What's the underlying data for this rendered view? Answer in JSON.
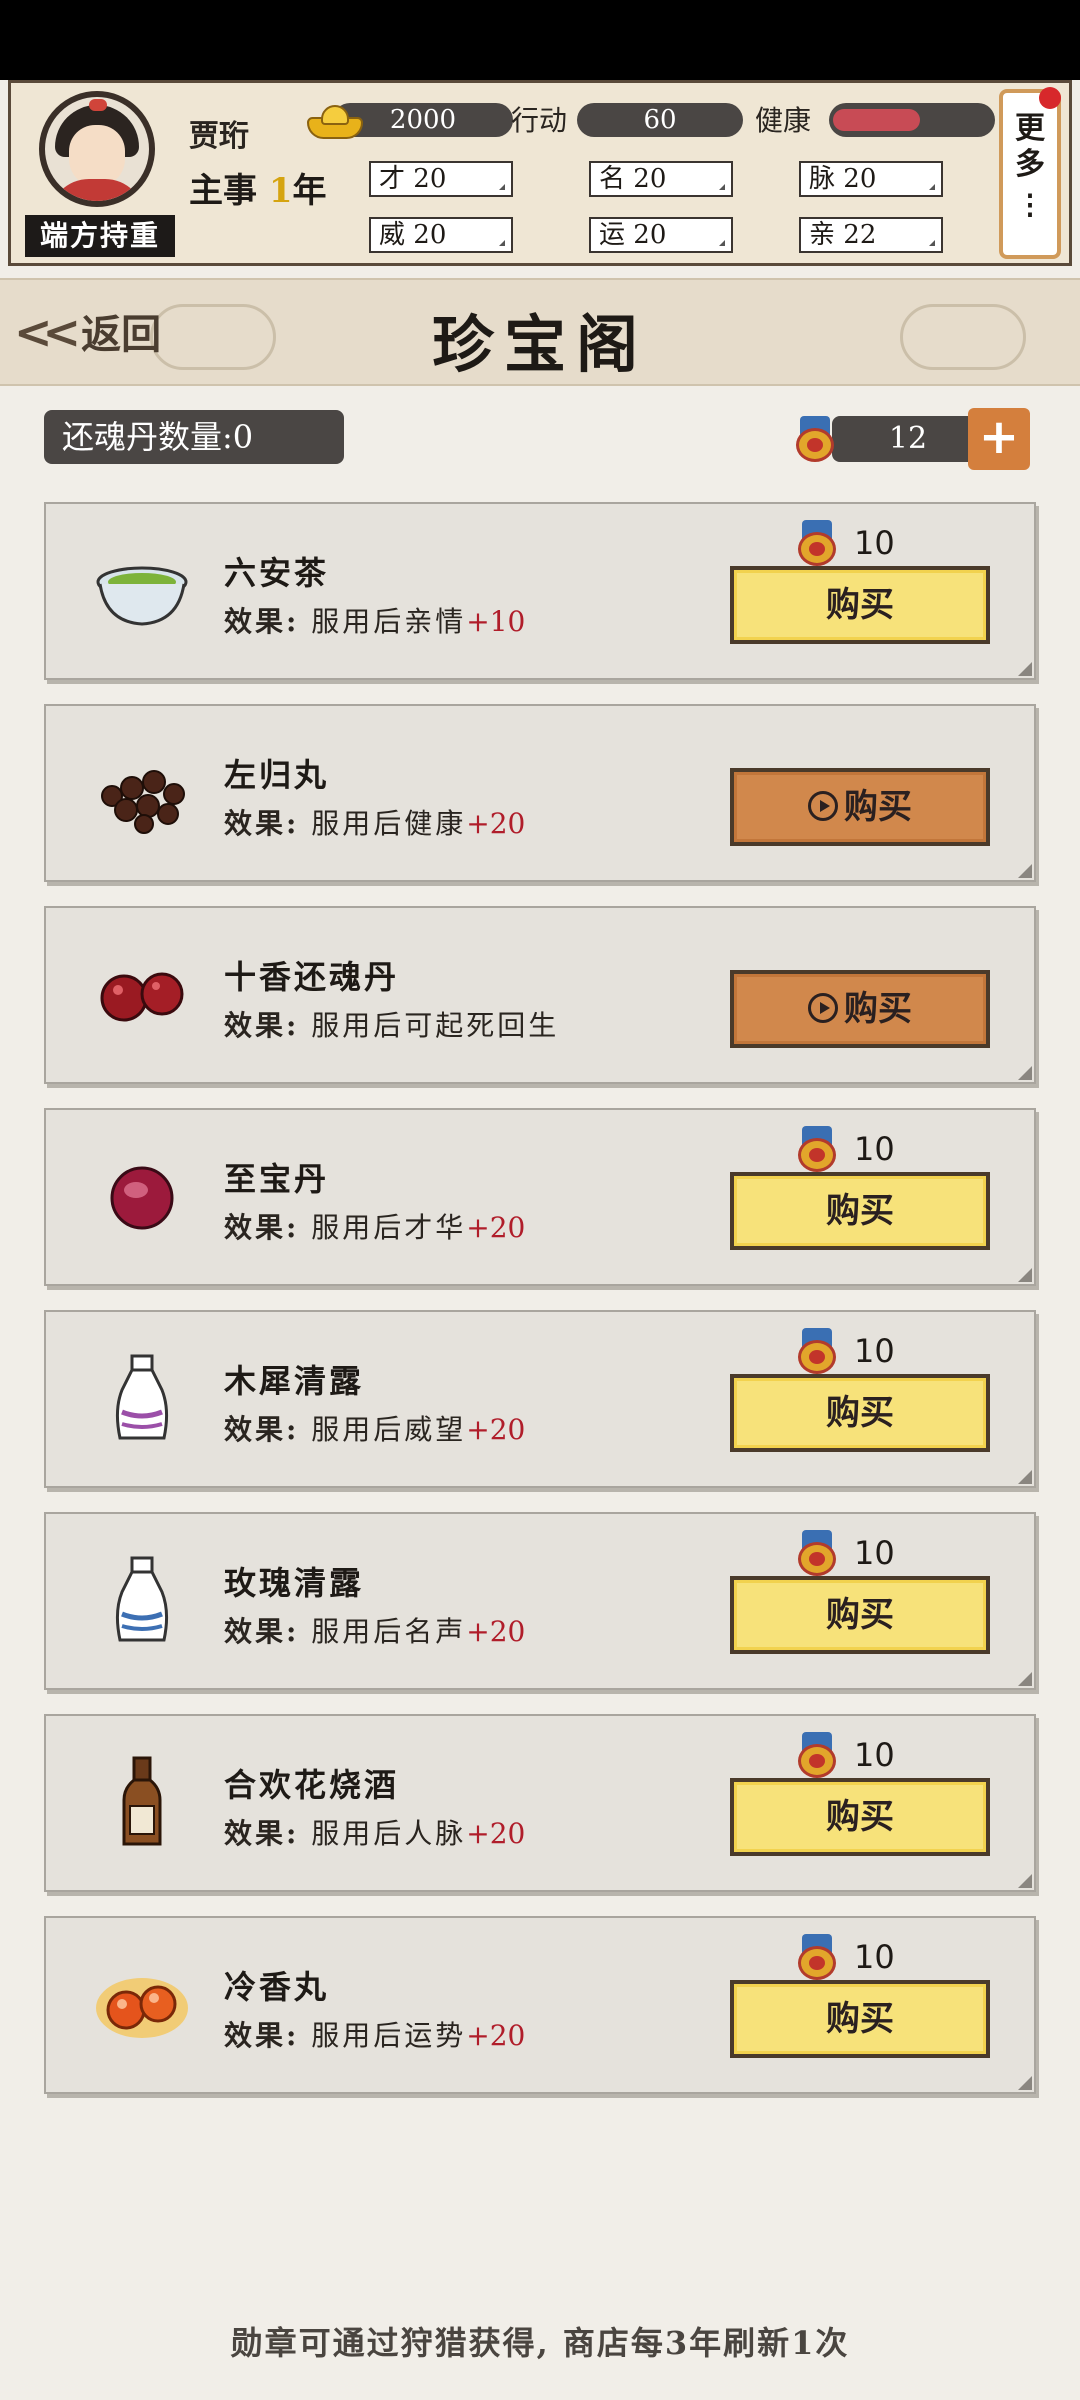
{
  "header": {
    "character": {
      "name": "贾珩",
      "title": "端方持重",
      "role": "主事",
      "years": "1",
      "year_unit": "年"
    },
    "currency": {
      "gold": "2000",
      "action_label": "行动",
      "action": "60",
      "health_label": "健康",
      "health_fraction": 0.55
    },
    "stats": [
      {
        "label": "才",
        "value": "20"
      },
      {
        "label": "名",
        "value": "20"
      },
      {
        "label": "脉",
        "value": "20"
      },
      {
        "label": "威",
        "value": "20"
      },
      {
        "label": "运",
        "value": "20"
      },
      {
        "label": "亲",
        "value": "22"
      }
    ],
    "more_label": "更多",
    "more_dots": "⋮"
  },
  "nav": {
    "back_label": "返回",
    "title": "珍宝阁"
  },
  "counters": {
    "revive_label": "还魂丹数量:0",
    "medals": "12",
    "add": "+"
  },
  "items": [
    {
      "name": "六安茶",
      "effect_key": "效果:",
      "effect": "服用后亲情",
      "delta": "+10",
      "price": "10",
      "buy": "购买",
      "mode": "price",
      "icon": "tea-bowl-icon"
    },
    {
      "name": "左归丸",
      "effect_key": "效果:",
      "effect": "服用后健康",
      "delta": "+20",
      "price": "",
      "buy": "购买",
      "mode": "video",
      "icon": "pills-icon"
    },
    {
      "name": "十香还魂丹",
      "effect_key": "效果:",
      "effect": "服用后可起死回生",
      "delta": "",
      "price": "",
      "buy": "购买",
      "mode": "video",
      "icon": "red-pills-icon"
    },
    {
      "name": "至宝丹",
      "effect_key": "效果:",
      "effect": "服用后才华",
      "delta": "+20",
      "price": "10",
      "buy": "购买",
      "mode": "price",
      "icon": "red-pill-icon"
    },
    {
      "name": "木犀清露",
      "effect_key": "效果:",
      "effect": "服用后威望",
      "delta": "+20",
      "price": "10",
      "buy": "购买",
      "mode": "price",
      "icon": "bottle-purple-icon"
    },
    {
      "name": "玫瑰清露",
      "effect_key": "效果:",
      "effect": "服用后名声",
      "delta": "+20",
      "price": "10",
      "buy": "购买",
      "mode": "price",
      "icon": "bottle-blue-icon"
    },
    {
      "name": "合欢花烧酒",
      "effect_key": "效果:",
      "effect": "服用后人脉",
      "delta": "+20",
      "price": "10",
      "buy": "购买",
      "mode": "price",
      "icon": "wine-bottle-icon"
    },
    {
      "name": "冷香丸",
      "effect_key": "效果:",
      "effect": "服用后运势",
      "delta": "+20",
      "price": "10",
      "buy": "购买",
      "mode": "price",
      "icon": "orange-pills-icon"
    }
  ],
  "footer": "勋章可通过狩猎获得, 商店每3年刷新1次",
  "colors": {
    "accent_orange": "#d47f3d",
    "buy_yellow": "#f7e27a",
    "delta_red": "#b01d2a",
    "health_red": "#c84b55"
  }
}
